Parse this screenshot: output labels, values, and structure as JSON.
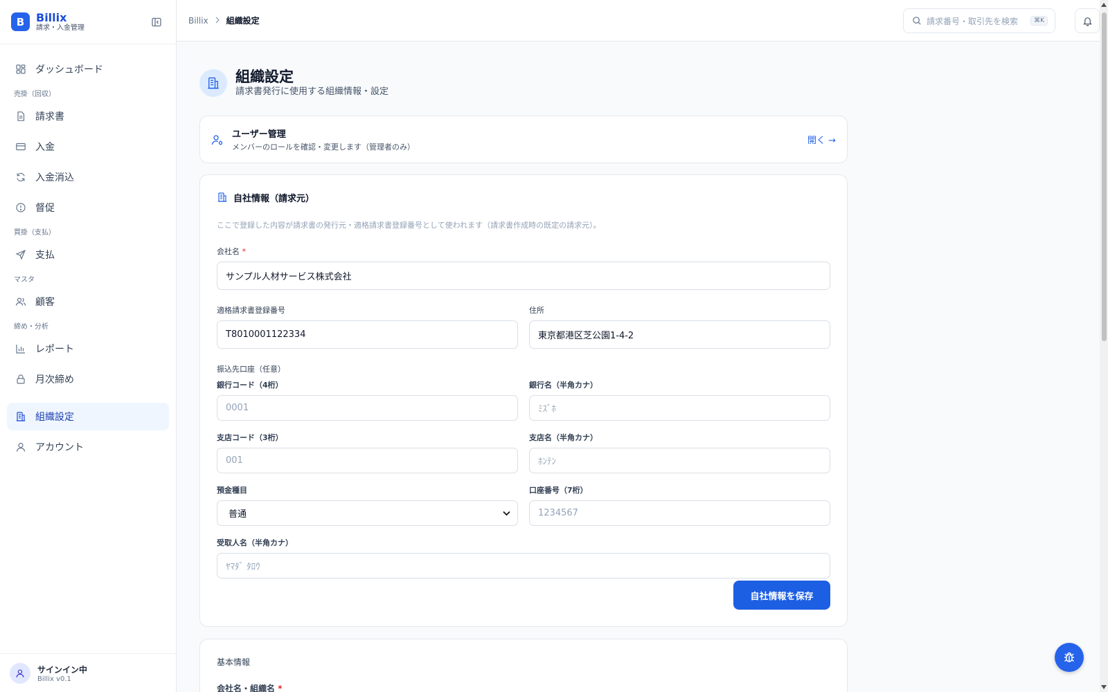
{
  "app": {
    "name": "Billix",
    "subtitle": "請求・入金管理",
    "logo_letter": "B",
    "version": "Billix v0.1"
  },
  "colors": {
    "accent": "#2563eb",
    "active_bg": "#eff6ff",
    "required": "#dc2626"
  },
  "sidebar": {
    "dashboard": "ダッシュボード",
    "groups": {
      "receivable": "売掛（回収）",
      "payable": "買掛（支払）",
      "master": "マスタ",
      "closing": "締め・分析"
    },
    "items": {
      "invoices": "請求書",
      "payments_in": "入金",
      "reconcile": "入金消込",
      "dunning": "督促",
      "payments_out": "支払",
      "customers": "顧客",
      "reports": "レポート",
      "monthly_close": "月次締め",
      "org_settings": "組織設定",
      "account": "アカウント"
    },
    "footer": {
      "name": "サインイン中"
    }
  },
  "topbar": {
    "breadcrumb": {
      "root": "Billix",
      "current": "組織設定"
    },
    "search": {
      "placeholder": "請求番号・取引先を検索",
      "shortcut": "⌘K"
    }
  },
  "page": {
    "title": "組織設定",
    "subtitle": "請求書発行に使用する組織情報・設定"
  },
  "user_mgmt": {
    "title": "ユーザー管理",
    "desc": "メンバーのロールを確認・変更します（管理者のみ）",
    "link": "開く →"
  },
  "company": {
    "title": "自社情報（請求元）",
    "note": "ここで登録した内容が請求書の発行元・適格請求書登録番号として使われます（請求書作成時の既定の請求元）。",
    "name_label": "会社名",
    "required_mark": "*",
    "name_value": "サンプル人材サービス株式会社",
    "reg_label": "適格請求書登録番号",
    "reg_value": "T8010001122334",
    "address_label": "住所",
    "address_value": "東京都港区芝公園1-4-2",
    "bank_section": "振込先口座（任意）",
    "bank_code_label": "銀行コード（4桁）",
    "bank_code_ph": "0001",
    "bank_name_label": "銀行名（半角カナ）",
    "bank_name_ph": "ﾐｽﾞﾎ",
    "branch_code_label": "支店コード（3桁）",
    "branch_code_ph": "001",
    "branch_name_label": "支店名（半角カナ）",
    "branch_name_ph": "ﾎﾝﾃﾝ",
    "deposit_type_label": "預金種目",
    "deposit_type_value": "普通",
    "account_no_label": "口座番号（7桁）",
    "account_no_ph": "1234567",
    "holder_label": "受取人名（半角カナ）",
    "holder_ph": "ﾔﾏﾀﾞ ﾀﾛｳ",
    "save": "自社情報を保存"
  },
  "basic": {
    "title": "基本情報",
    "org_name_label": "会社名・組織名"
  }
}
